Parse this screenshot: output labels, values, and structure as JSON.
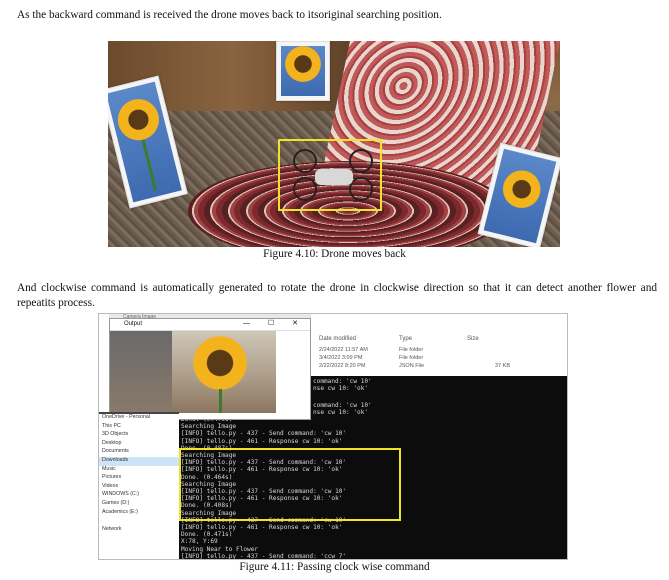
{
  "paragraph1": "As the backward command is received the drone moves back to itsoriginal searching position.",
  "caption1": "Figure 4.10: Drone moves back",
  "paragraph2": "And clockwise command is automatically generated to rotate the drone in clockwise direction so that it can detect another flower and repeatits process.",
  "caption2": "Figure 4.11: Passing clock wise command",
  "screenshot": {
    "camera_title": "Camera Image",
    "output_title": "Output",
    "window_controls": "— ☐ ✕",
    "explorer_headers": {
      "date": "Date modified",
      "type": "Type",
      "size": "Size"
    },
    "explorer_rows": [
      {
        "date": "2/24/2022 11:57 AM",
        "type": "File folder",
        "size": ""
      },
      {
        "date": "3/4/2022 3:09 PM",
        "type": "File folder",
        "size": ""
      },
      {
        "date": "2/22/2022 8:20 PM",
        "type": "JSON File",
        "size": "37 KB"
      }
    ],
    "nav_items": [
      "OneDrive - Personal",
      "This PC",
      "3D Objects",
      "Desktop",
      "Documents",
      "Downloads",
      "Music",
      "Pictures",
      "Videos",
      "WINDOWS (C:)",
      "Games (D:)",
      "Academics (E:)",
      "",
      "Network"
    ],
    "nav_selected": 5,
    "terminal_top": [
      "command: 'cw 10'",
      "nse cw 10: 'ok'",
      "",
      "command: 'cw 10'",
      "nse cw 10: 'ok'"
    ],
    "terminal_lines": [
      "Done. (0.470s)",
      "Searching Image",
      "[INFO] tello.py - 437 - Send command: 'cw 10'",
      "[INFO] tello.py - 461 - Response cw 10: 'ok'",
      "Done. (0.487s)",
      "Searching Image",
      "[INFO] tello.py - 437 - Send command: 'cw 10'",
      "[INFO] tello.py - 461 - Response cw 10: 'ok'",
      "Done. (0.464s)",
      "Searching Image",
      "[INFO] tello.py - 437 - Send command: 'cw 10'",
      "[INFO] tello.py - 461 - Response cw 10: 'ok'",
      "Done. (0.408s)",
      "Searching Image",
      "[INFO] tello.py - 437 - Send command: 'cw 10'",
      "[INFO] tello.py - 461 - Response cw 10: 'ok'",
      "Done. (0.471s)",
      "X:78, Y:69",
      "Moving Near to Flower",
      "[INFO] tello.py - 437 - Send command: 'ccw 7'",
      "[INFO] tello.py - 461 - Response ccw 7: 'ok'"
    ]
  }
}
